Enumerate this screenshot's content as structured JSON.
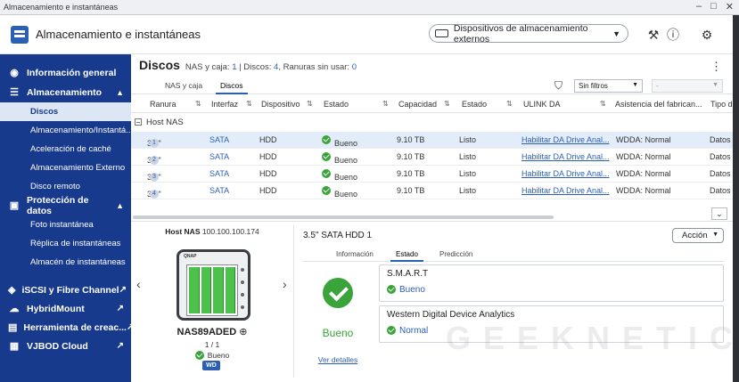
{
  "window": {
    "title": "Almacenamiento e instantáneas",
    "controls": [
      "–",
      "□",
      "✕"
    ]
  },
  "header": {
    "title": "Almacenamiento e instantáneas",
    "external_button": "Dispositivos de almacenamiento externos"
  },
  "sidebar": {
    "groups": [
      {
        "label": "Información general",
        "icon": "dashboard-icon"
      },
      {
        "label": "Almacenamiento",
        "icon": "storage-icon",
        "items": [
          "Discos",
          "Almacenamiento/Instantá...",
          "Aceleración de caché",
          "Almacenamiento Externo",
          "Disco remoto"
        ]
      },
      {
        "label": "Protección de datos",
        "icon": "protection-icon",
        "items": [
          "Foto instantánea",
          "Réplica de instantáneas",
          "Almacén de instantáneas"
        ]
      }
    ],
    "links": [
      "iSCSI y Fibre Channel",
      "HybridMount",
      "Herramienta de creac...",
      "VJBOD Cloud"
    ]
  },
  "page": {
    "title": "Discos",
    "stats": {
      "nas_label": "NAS y caja:",
      "nas_value": "1",
      "disks_label": "Discos:",
      "disks_value": "4",
      "slots_label": "Ranuras sin usar:",
      "slots_value": "0"
    },
    "tabs": [
      "NAS y caja",
      "Discos"
    ],
    "filter": {
      "selected": "Sin filtros",
      "second": "-"
    }
  },
  "table": {
    "columns": [
      "Ranura",
      "Interfaz",
      "Dispositivo",
      "Estado",
      "Capacidad",
      "Estado",
      "ULINK DA",
      "Asistencia del fabrican...",
      "Tipo d"
    ],
    "group": "Host NAS",
    "rows": [
      {
        "slot": "3.5\"",
        "n": "1",
        "iface": "SATA",
        "device": "HDD",
        "status": "Bueno",
        "capacity": "9.10 TB",
        "state": "Listo",
        "ulink": "Habilitar DA Drive Anal...",
        "assist": "WDDA: Normal",
        "type": "Datos"
      },
      {
        "slot": "3.5\"",
        "n": "2",
        "iface": "SATA",
        "device": "HDD",
        "status": "Bueno",
        "capacity": "9.10 TB",
        "state": "Listo",
        "ulink": "Habilitar DA Drive Anal...",
        "assist": "WDDA: Normal",
        "type": "Datos"
      },
      {
        "slot": "3.5\"",
        "n": "3",
        "iface": "SATA",
        "device": "HDD",
        "status": "Bueno",
        "capacity": "9.10 TB",
        "state": "Listo",
        "ulink": "Habilitar DA Drive Anal...",
        "assist": "WDDA: Normal",
        "type": "Datos"
      },
      {
        "slot": "3.5\"",
        "n": "4",
        "iface": "SATA",
        "device": "HDD",
        "status": "Bueno",
        "capacity": "9.10 TB",
        "state": "Listo",
        "ulink": "Habilitar DA Drive Anal...",
        "assist": "WDDA: Normal",
        "type": "Datos"
      }
    ]
  },
  "enclosure": {
    "host_label": "Host NAS",
    "host_ip": "100.100.100.174",
    "logo": "QNAP",
    "name": "NAS89ADED",
    "count": "1 / 1",
    "status": "Bueno",
    "brand_badge": "WD"
  },
  "detail": {
    "title": "3.5\" SATA HDD 1",
    "action": "Acción",
    "tabs": [
      "Información",
      "Estado",
      "Predicción"
    ],
    "overall": "Bueno",
    "details_link": "Ver detalles",
    "cards": [
      {
        "title": "S.M.A.R.T",
        "status": "Bueno"
      },
      {
        "title": "Western Digital Device Analytics",
        "status": "Normal"
      }
    ]
  },
  "watermark": "GEEKNETIC",
  "colors": {
    "sidebar": "#173a8c",
    "accent": "#2b5fb4",
    "ok": "#3aa33a"
  }
}
